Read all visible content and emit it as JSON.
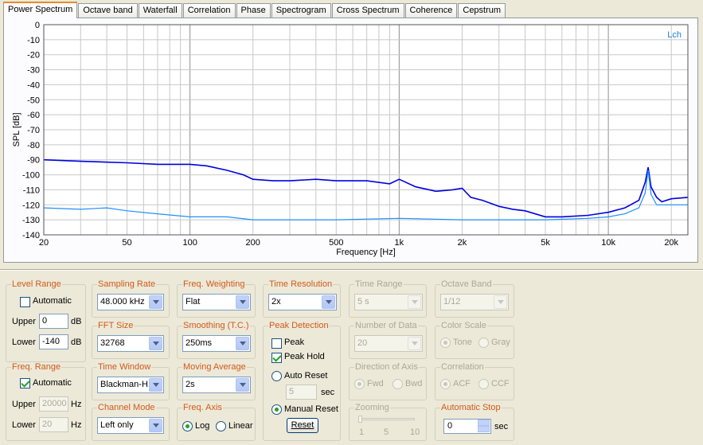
{
  "tabs": [
    "Power Spectrum",
    "Octave band",
    "Waterfall",
    "Correlation",
    "Phase",
    "Spectrogram",
    "Cross Spectrum",
    "Coherence",
    "Cepstrum"
  ],
  "chart_data": {
    "type": "line",
    "ylabel": "SPL [dB]",
    "xlabel": "Frequency [Hz]",
    "xscale": "log",
    "xlim": [
      20,
      24000
    ],
    "ylim": [
      -140,
      0
    ],
    "yticks": [
      "0",
      "-10",
      "-20",
      "-30",
      "-40",
      "-50",
      "-60",
      "-70",
      "-80",
      "-90",
      "-100",
      "-110",
      "-120",
      "-130",
      "-140"
    ],
    "xticks": [
      {
        "v": 20,
        "l": "20"
      },
      {
        "v": 50,
        "l": "50"
      },
      {
        "v": 100,
        "l": "100"
      },
      {
        "v": 200,
        "l": "200"
      },
      {
        "v": 500,
        "l": "500"
      },
      {
        "v": 1000,
        "l": "1k"
      },
      {
        "v": 2000,
        "l": "2k"
      },
      {
        "v": 5000,
        "l": "5k"
      },
      {
        "v": 10000,
        "l": "10k"
      },
      {
        "v": 20000,
        "l": "20k"
      }
    ],
    "channel_label": "Lch",
    "grid": true,
    "series": [
      {
        "color": "#0000e0",
        "x": [
          20,
          30,
          50,
          70,
          100,
          120,
          150,
          180,
          200,
          250,
          300,
          400,
          500,
          700,
          900,
          1000,
          1200,
          1500,
          1800,
          2000,
          2200,
          2500,
          3000,
          3500,
          4000,
          5000,
          6000,
          8000,
          10000,
          12000,
          14000,
          15000,
          15500,
          16000,
          17000,
          18000,
          20000,
          24000
        ],
        "y": [
          -90,
          -91,
          -92,
          -93,
          -93,
          -94,
          -97,
          -100,
          -103,
          -104,
          -104,
          -103,
          -104,
          -104,
          -106,
          -103,
          -108,
          -111,
          -110,
          -109,
          -115,
          -117,
          -121,
          -123,
          -124,
          -128,
          -128,
          -127,
          -125,
          -122,
          -117,
          -105,
          -95,
          -108,
          -115,
          -118,
          -116,
          -115
        ]
      },
      {
        "color": "#1e90ff",
        "x": [
          20,
          30,
          40,
          50,
          70,
          100,
          150,
          200,
          300,
          500,
          1000,
          2000,
          5000,
          8000,
          10000,
          12000,
          14000,
          15000,
          15500,
          16000,
          17000,
          20000,
          24000
        ],
        "y": [
          -122,
          -123,
          -122,
          -124,
          -126,
          -128,
          -128,
          -130,
          -130,
          -130,
          -129,
          -130,
          -130,
          -129,
          -128,
          -126,
          -122,
          -112,
          -97,
          -113,
          -120,
          -120,
          -120
        ]
      }
    ]
  },
  "level_range": {
    "title": "Level Range",
    "automatic_label": "Automatic",
    "upper_label": "Upper",
    "upper_value": "0",
    "upper_unit": "dB",
    "lower_label": "Lower",
    "lower_value": "-140",
    "lower_unit": "dB"
  },
  "freq_range": {
    "title": "Freq. Range",
    "automatic_label": "Automatic",
    "upper_label": "Upper",
    "upper_value": "20000",
    "upper_unit": "Hz",
    "lower_label": "Lower",
    "lower_value": "20",
    "lower_unit": "Hz"
  },
  "sampling_rate": {
    "title": "Sampling Rate",
    "value": "48.000 kHz"
  },
  "fft_size": {
    "title": "FFT Size",
    "value": "32768"
  },
  "time_window": {
    "title": "Time Window",
    "value": "Blackman-H..."
  },
  "channel_mode": {
    "title": "Channel Mode",
    "value": "Left only"
  },
  "freq_weighting": {
    "title": "Freq. Weighting",
    "value": "Flat"
  },
  "smoothing": {
    "title": "Smoothing (T.C.)",
    "value": "250ms"
  },
  "moving_average": {
    "title": "Moving Average",
    "value": "2s"
  },
  "freq_axis": {
    "title": "Freq. Axis",
    "log": "Log",
    "linear": "Linear"
  },
  "time_resolution": {
    "title": "Time Resolution",
    "value": "2x"
  },
  "peak_detection": {
    "title": "Peak Detection",
    "peak": "Peak",
    "peak_hold": "Peak Hold",
    "auto_reset": "Auto Reset",
    "auto_value": "5",
    "auto_unit": "sec",
    "manual_reset": "Manual Reset",
    "reset_button": "Reset"
  },
  "time_range": {
    "title": "Time Range",
    "value": "5 s"
  },
  "number_of_data": {
    "title": "Number of Data",
    "value": "20"
  },
  "direction_of_axis": {
    "title": "Direction of Axis",
    "fwd": "Fwd",
    "bwd": "Bwd"
  },
  "zooming": {
    "title": "Zooming",
    "t1": "1",
    "t5": "5",
    "t10": "10"
  },
  "octave_band": {
    "title": "Octave Band",
    "value": "1/12"
  },
  "color_scale": {
    "title": "Color Scale",
    "tone": "Tone",
    "gray": "Gray"
  },
  "correlation": {
    "title": "Correlation",
    "acf": "ACF",
    "ccf": "CCF"
  },
  "automatic_stop": {
    "title": "Automatic Stop",
    "value": "0",
    "unit": "sec"
  }
}
